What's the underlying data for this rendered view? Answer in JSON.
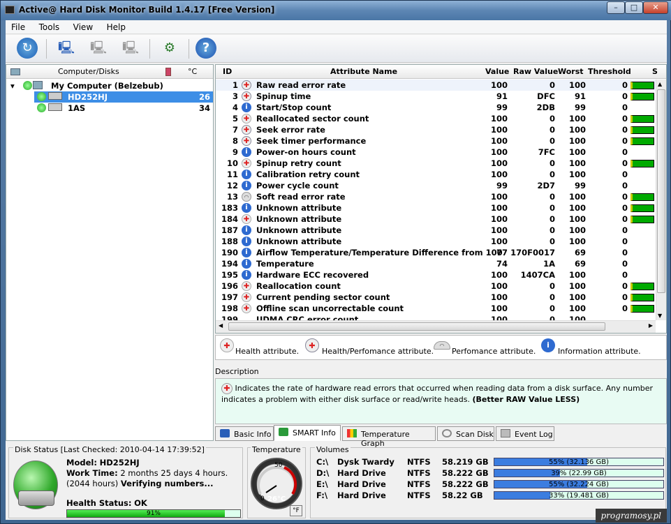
{
  "window": {
    "title": "Active@ Hard Disk Monitor Build 1.4.17 [Free Version]",
    "min": "–",
    "max": "□",
    "close": "✕"
  },
  "menu": [
    "File",
    "Tools",
    "View",
    "Help"
  ],
  "tree": {
    "header": {
      "col1": "Computer/Disks",
      "col2": "°C"
    },
    "root": {
      "label": "My Computer (Belzebub)"
    },
    "disks": [
      {
        "name": "HD252HJ",
        "temp": "26"
      },
      {
        "name": "1AS",
        "temp": "34"
      }
    ]
  },
  "smart": {
    "headers": {
      "id": "ID",
      "name": "Attribute Name",
      "value": "Value",
      "raw": "Raw Value",
      "worst": "Worst",
      "threshold": "Threshold",
      "status": "S"
    },
    "rows": [
      {
        "id": "1",
        "icon": "hp",
        "name": "Raw read error rate",
        "value": "100",
        "raw": "0",
        "worst": "100",
        "thr": "0",
        "bar": true
      },
      {
        "id": "3",
        "icon": "hp",
        "name": "Spinup time",
        "value": "91",
        "raw": "DFC",
        "worst": "91",
        "thr": "0",
        "bar": true
      },
      {
        "id": "4",
        "icon": "info",
        "name": "Start/Stop count",
        "value": "99",
        "raw": "2DB",
        "worst": "99",
        "thr": "0",
        "bar": false
      },
      {
        "id": "5",
        "icon": "health",
        "name": "Reallocated sector count",
        "value": "100",
        "raw": "0",
        "worst": "100",
        "thr": "0",
        "bar": true
      },
      {
        "id": "7",
        "icon": "hp",
        "name": "Seek error rate",
        "value": "100",
        "raw": "0",
        "worst": "100",
        "thr": "0",
        "bar": true
      },
      {
        "id": "8",
        "icon": "hp",
        "name": "Seek timer performance",
        "value": "100",
        "raw": "0",
        "worst": "100",
        "thr": "0",
        "bar": true
      },
      {
        "id": "9",
        "icon": "info",
        "name": "Power-on hours count",
        "value": "100",
        "raw": "7FC",
        "worst": "100",
        "thr": "0",
        "bar": false
      },
      {
        "id": "10",
        "icon": "health",
        "name": "Spinup retry count",
        "value": "100",
        "raw": "0",
        "worst": "100",
        "thr": "0",
        "bar": true
      },
      {
        "id": "11",
        "icon": "info",
        "name": "Calibration retry count",
        "value": "100",
        "raw": "0",
        "worst": "100",
        "thr": "0",
        "bar": false
      },
      {
        "id": "12",
        "icon": "info",
        "name": "Power cycle count",
        "value": "99",
        "raw": "2D7",
        "worst": "99",
        "thr": "0",
        "bar": false
      },
      {
        "id": "13",
        "icon": "perf",
        "name": "Soft read error rate",
        "value": "100",
        "raw": "0",
        "worst": "100",
        "thr": "0",
        "bar": true
      },
      {
        "id": "183",
        "icon": "info",
        "name": "Unknown attribute",
        "value": "100",
        "raw": "0",
        "worst": "100",
        "thr": "0",
        "bar": true
      },
      {
        "id": "184",
        "icon": "health",
        "name": "Unknown attribute",
        "value": "100",
        "raw": "0",
        "worst": "100",
        "thr": "0",
        "bar": true
      },
      {
        "id": "187",
        "icon": "info",
        "name": "Unknown attribute",
        "value": "100",
        "raw": "0",
        "worst": "100",
        "thr": "0",
        "bar": false
      },
      {
        "id": "188",
        "icon": "info",
        "name": "Unknown attribute",
        "value": "100",
        "raw": "0",
        "worst": "100",
        "thr": "0",
        "bar": false
      },
      {
        "id": "190",
        "icon": "info",
        "name": "Airflow Temperature/Temperature Difference from 100",
        "value": "77",
        "raw": "170F0017",
        "worst": "69",
        "thr": "0",
        "bar": false
      },
      {
        "id": "194",
        "icon": "info",
        "name": "Temperature",
        "value": "74",
        "raw": "1A",
        "worst": "69",
        "thr": "0",
        "bar": false
      },
      {
        "id": "195",
        "icon": "info",
        "name": "Hardware ECC recovered",
        "value": "100",
        "raw": "1407CA",
        "worst": "100",
        "thr": "0",
        "bar": false
      },
      {
        "id": "196",
        "icon": "health",
        "name": "Reallocation count",
        "value": "100",
        "raw": "0",
        "worst": "100",
        "thr": "0",
        "bar": true
      },
      {
        "id": "197",
        "icon": "health",
        "name": "Current pending sector count",
        "value": "100",
        "raw": "0",
        "worst": "100",
        "thr": "0",
        "bar": true
      },
      {
        "id": "198",
        "icon": "health",
        "name": "Offline scan uncorrectable count",
        "value": "100",
        "raw": "0",
        "worst": "100",
        "thr": "0",
        "bar": true
      }
    ],
    "partial_row": {
      "id": "199",
      "name": "UDMA CRC error count",
      "value": "100",
      "raw": "0",
      "worst": "100"
    }
  },
  "legend": {
    "health": "Health attribute.",
    "hp": "Health/Perfomance attribute.",
    "perf": "Perfomance attribute.",
    "info": "Information attribute."
  },
  "description": {
    "label": "Description",
    "text": "Indicates the rate of hardware read errors that occurred when reading data from a disk surface. Any number indicates a problem with either disk surface or read/write heads.",
    "note": "(Better RAW Value LESS)"
  },
  "tabs": [
    "Basic Info",
    "SMART Info",
    "Temperature Graph",
    "Scan Disk",
    "Event Log"
  ],
  "disk_status": {
    "label": "Disk Status [Last Checked: 2010-04-14 17:39:52]",
    "model_label": "Model:",
    "model": "HD252HJ",
    "work_label": "Work Time:",
    "work": "2 months 25 days 4 hours. (2044 hours)",
    "verifying": "Verifying numbers...",
    "health_label": "Health Status:",
    "health": "OK",
    "health_pct": 91,
    "health_text": "91%"
  },
  "temperature": {
    "label": "Temperature",
    "reading": "26°C",
    "dial_max": "50",
    "dial_min": "0",
    "unit_button": "°F"
  },
  "volumes": {
    "label": "Volumes",
    "items": [
      {
        "drive": "C:\\",
        "name": "Dysk Twardy",
        "fs": "NTFS",
        "size": "58.219 GB",
        "pct": 55,
        "text": "55% (32.136 GB)"
      },
      {
        "drive": "D:\\",
        "name": "Hard Drive",
        "fs": "NTFS",
        "size": "58.222 GB",
        "pct": 39,
        "text": "39% (22.99 GB)"
      },
      {
        "drive": "E:\\",
        "name": "Hard Drive",
        "fs": "NTFS",
        "size": "58.222 GB",
        "pct": 55,
        "text": "55% (32.224 GB)"
      },
      {
        "drive": "F:\\",
        "name": "Hard Drive",
        "fs": "NTFS",
        "size": "58.22 GB",
        "pct": 33,
        "text": "33% (19.481 GB)"
      }
    ]
  },
  "watermark": "programosy.pl"
}
